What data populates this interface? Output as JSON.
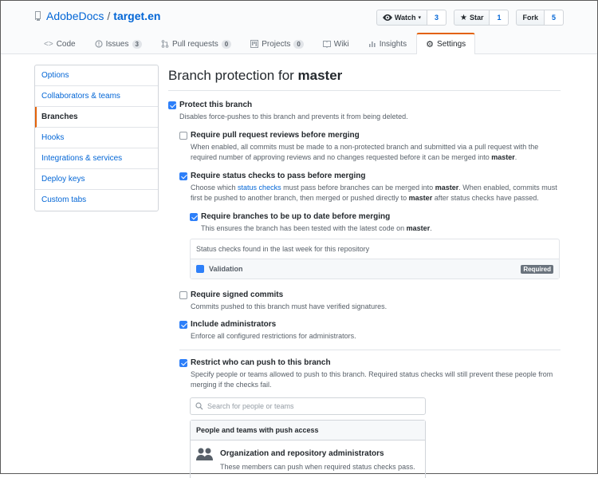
{
  "repo": {
    "owner": "AdobeDocs",
    "separator": "/",
    "name": "target.en"
  },
  "actions": [
    {
      "label": "Watch",
      "count": "3"
    },
    {
      "label": "Star",
      "count": "1"
    },
    {
      "label": "Fork",
      "count": "5"
    }
  ],
  "tabs": [
    {
      "label": "Code",
      "badge": ""
    },
    {
      "label": "Issues",
      "badge": "3"
    },
    {
      "label": "Pull requests",
      "badge": "0"
    },
    {
      "label": "Projects",
      "badge": "0"
    },
    {
      "label": "Wiki",
      "badge": ""
    },
    {
      "label": "Insights",
      "badge": ""
    },
    {
      "label": "Settings",
      "badge": ""
    }
  ],
  "sidebar": {
    "items": [
      "Options",
      "Collaborators & teams",
      "Branches",
      "Hooks",
      "Integrations & services",
      "Deploy keys",
      "Custom tabs"
    ],
    "selected": "Branches"
  },
  "page": {
    "title_prefix": "Branch protection for ",
    "branch": "master"
  },
  "protect": {
    "label": "Protect this branch",
    "note": "Disables force-pushes to this branch and prevents it from being deleted.",
    "checked": true
  },
  "reviews": {
    "label": "Require pull request reviews before merging",
    "note_a": "When enabled, all commits must be made to a non-protected branch and submitted via a pull request with the required number of approving reviews and no changes requested before it can be merged into ",
    "note_b": "master",
    "note_c": ".",
    "checked": false
  },
  "status_checks": {
    "label": "Require status checks to pass before merging",
    "note_a": "Choose which ",
    "link": "status checks",
    "note_b": " must pass before branches can be merged into ",
    "note_c": "master",
    "note_d": ". When enabled, commits must first be pushed to another branch, then merged or pushed directly to ",
    "note_e": "master",
    "note_f": " after status checks have passed.",
    "checked": true
  },
  "up_to_date": {
    "label": "Require branches to be up to date before merging",
    "note_a": "This ensures the branch has been tested with the latest code on ",
    "note_b": "master",
    "note_c": ".",
    "checked": true
  },
  "status_box": {
    "header": "Status checks found in the last week for this repository",
    "check": "Validation",
    "badge": "Required",
    "checked": true
  },
  "signed": {
    "label": "Require signed commits",
    "note": "Commits pushed to this branch must have verified signatures.",
    "checked": false
  },
  "admins": {
    "label": "Include administrators",
    "note": "Enforce all configured restrictions for administrators.",
    "checked": true
  },
  "restrict": {
    "label": "Restrict who can push to this branch",
    "note": "Specify people or teams allowed to push to this branch. Required status checks will still prevent these people from merging if the checks fail.",
    "checked": true
  },
  "search": {
    "placeholder": "Search for people or teams"
  },
  "push_access": {
    "header": "People and teams with push access",
    "entry_title": "Organization and repository administrators",
    "entry_desc": "These members can push when required status checks pass."
  }
}
